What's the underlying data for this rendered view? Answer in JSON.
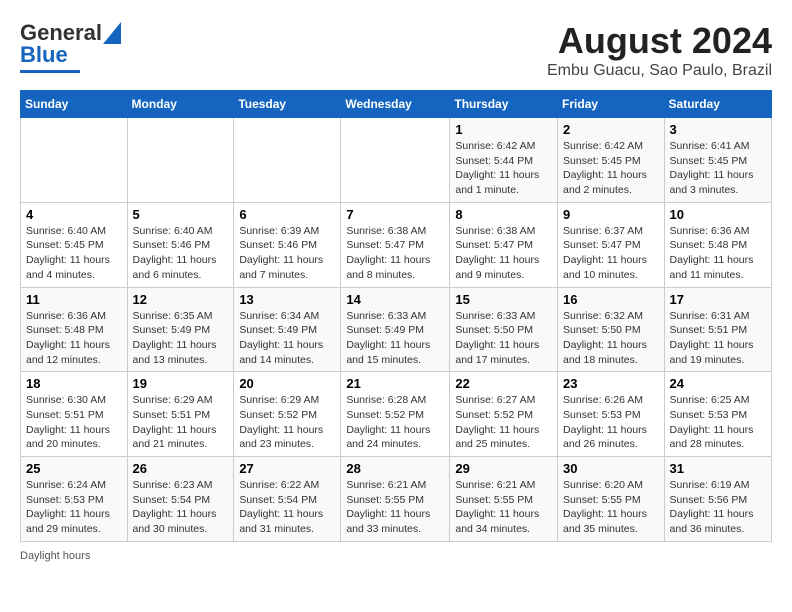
{
  "header": {
    "logo_line1": "General",
    "logo_line2": "Blue",
    "month_title": "August 2024",
    "location": "Embu Guacu, Sao Paulo, Brazil"
  },
  "days_of_week": [
    "Sunday",
    "Monday",
    "Tuesday",
    "Wednesday",
    "Thursday",
    "Friday",
    "Saturday"
  ],
  "weeks": [
    [
      {
        "day": "",
        "info": ""
      },
      {
        "day": "",
        "info": ""
      },
      {
        "day": "",
        "info": ""
      },
      {
        "day": "",
        "info": ""
      },
      {
        "day": "1",
        "info": "Sunrise: 6:42 AM\nSunset: 5:44 PM\nDaylight: 11 hours and 1 minute."
      },
      {
        "day": "2",
        "info": "Sunrise: 6:42 AM\nSunset: 5:45 PM\nDaylight: 11 hours and 2 minutes."
      },
      {
        "day": "3",
        "info": "Sunrise: 6:41 AM\nSunset: 5:45 PM\nDaylight: 11 hours and 3 minutes."
      }
    ],
    [
      {
        "day": "4",
        "info": "Sunrise: 6:40 AM\nSunset: 5:45 PM\nDaylight: 11 hours and 4 minutes."
      },
      {
        "day": "5",
        "info": "Sunrise: 6:40 AM\nSunset: 5:46 PM\nDaylight: 11 hours and 6 minutes."
      },
      {
        "day": "6",
        "info": "Sunrise: 6:39 AM\nSunset: 5:46 PM\nDaylight: 11 hours and 7 minutes."
      },
      {
        "day": "7",
        "info": "Sunrise: 6:38 AM\nSunset: 5:47 PM\nDaylight: 11 hours and 8 minutes."
      },
      {
        "day": "8",
        "info": "Sunrise: 6:38 AM\nSunset: 5:47 PM\nDaylight: 11 hours and 9 minutes."
      },
      {
        "day": "9",
        "info": "Sunrise: 6:37 AM\nSunset: 5:47 PM\nDaylight: 11 hours and 10 minutes."
      },
      {
        "day": "10",
        "info": "Sunrise: 6:36 AM\nSunset: 5:48 PM\nDaylight: 11 hours and 11 minutes."
      }
    ],
    [
      {
        "day": "11",
        "info": "Sunrise: 6:36 AM\nSunset: 5:48 PM\nDaylight: 11 hours and 12 minutes."
      },
      {
        "day": "12",
        "info": "Sunrise: 6:35 AM\nSunset: 5:49 PM\nDaylight: 11 hours and 13 minutes."
      },
      {
        "day": "13",
        "info": "Sunrise: 6:34 AM\nSunset: 5:49 PM\nDaylight: 11 hours and 14 minutes."
      },
      {
        "day": "14",
        "info": "Sunrise: 6:33 AM\nSunset: 5:49 PM\nDaylight: 11 hours and 15 minutes."
      },
      {
        "day": "15",
        "info": "Sunrise: 6:33 AM\nSunset: 5:50 PM\nDaylight: 11 hours and 17 minutes."
      },
      {
        "day": "16",
        "info": "Sunrise: 6:32 AM\nSunset: 5:50 PM\nDaylight: 11 hours and 18 minutes."
      },
      {
        "day": "17",
        "info": "Sunrise: 6:31 AM\nSunset: 5:51 PM\nDaylight: 11 hours and 19 minutes."
      }
    ],
    [
      {
        "day": "18",
        "info": "Sunrise: 6:30 AM\nSunset: 5:51 PM\nDaylight: 11 hours and 20 minutes."
      },
      {
        "day": "19",
        "info": "Sunrise: 6:29 AM\nSunset: 5:51 PM\nDaylight: 11 hours and 21 minutes."
      },
      {
        "day": "20",
        "info": "Sunrise: 6:29 AM\nSunset: 5:52 PM\nDaylight: 11 hours and 23 minutes."
      },
      {
        "day": "21",
        "info": "Sunrise: 6:28 AM\nSunset: 5:52 PM\nDaylight: 11 hours and 24 minutes."
      },
      {
        "day": "22",
        "info": "Sunrise: 6:27 AM\nSunset: 5:52 PM\nDaylight: 11 hours and 25 minutes."
      },
      {
        "day": "23",
        "info": "Sunrise: 6:26 AM\nSunset: 5:53 PM\nDaylight: 11 hours and 26 minutes."
      },
      {
        "day": "24",
        "info": "Sunrise: 6:25 AM\nSunset: 5:53 PM\nDaylight: 11 hours and 28 minutes."
      }
    ],
    [
      {
        "day": "25",
        "info": "Sunrise: 6:24 AM\nSunset: 5:53 PM\nDaylight: 11 hours and 29 minutes."
      },
      {
        "day": "26",
        "info": "Sunrise: 6:23 AM\nSunset: 5:54 PM\nDaylight: 11 hours and 30 minutes."
      },
      {
        "day": "27",
        "info": "Sunrise: 6:22 AM\nSunset: 5:54 PM\nDaylight: 11 hours and 31 minutes."
      },
      {
        "day": "28",
        "info": "Sunrise: 6:21 AM\nSunset: 5:55 PM\nDaylight: 11 hours and 33 minutes."
      },
      {
        "day": "29",
        "info": "Sunrise: 6:21 AM\nSunset: 5:55 PM\nDaylight: 11 hours and 34 minutes."
      },
      {
        "day": "30",
        "info": "Sunrise: 6:20 AM\nSunset: 5:55 PM\nDaylight: 11 hours and 35 minutes."
      },
      {
        "day": "31",
        "info": "Sunrise: 6:19 AM\nSunset: 5:56 PM\nDaylight: 11 hours and 36 minutes."
      }
    ]
  ],
  "footer": {
    "text": "Daylight hours"
  }
}
